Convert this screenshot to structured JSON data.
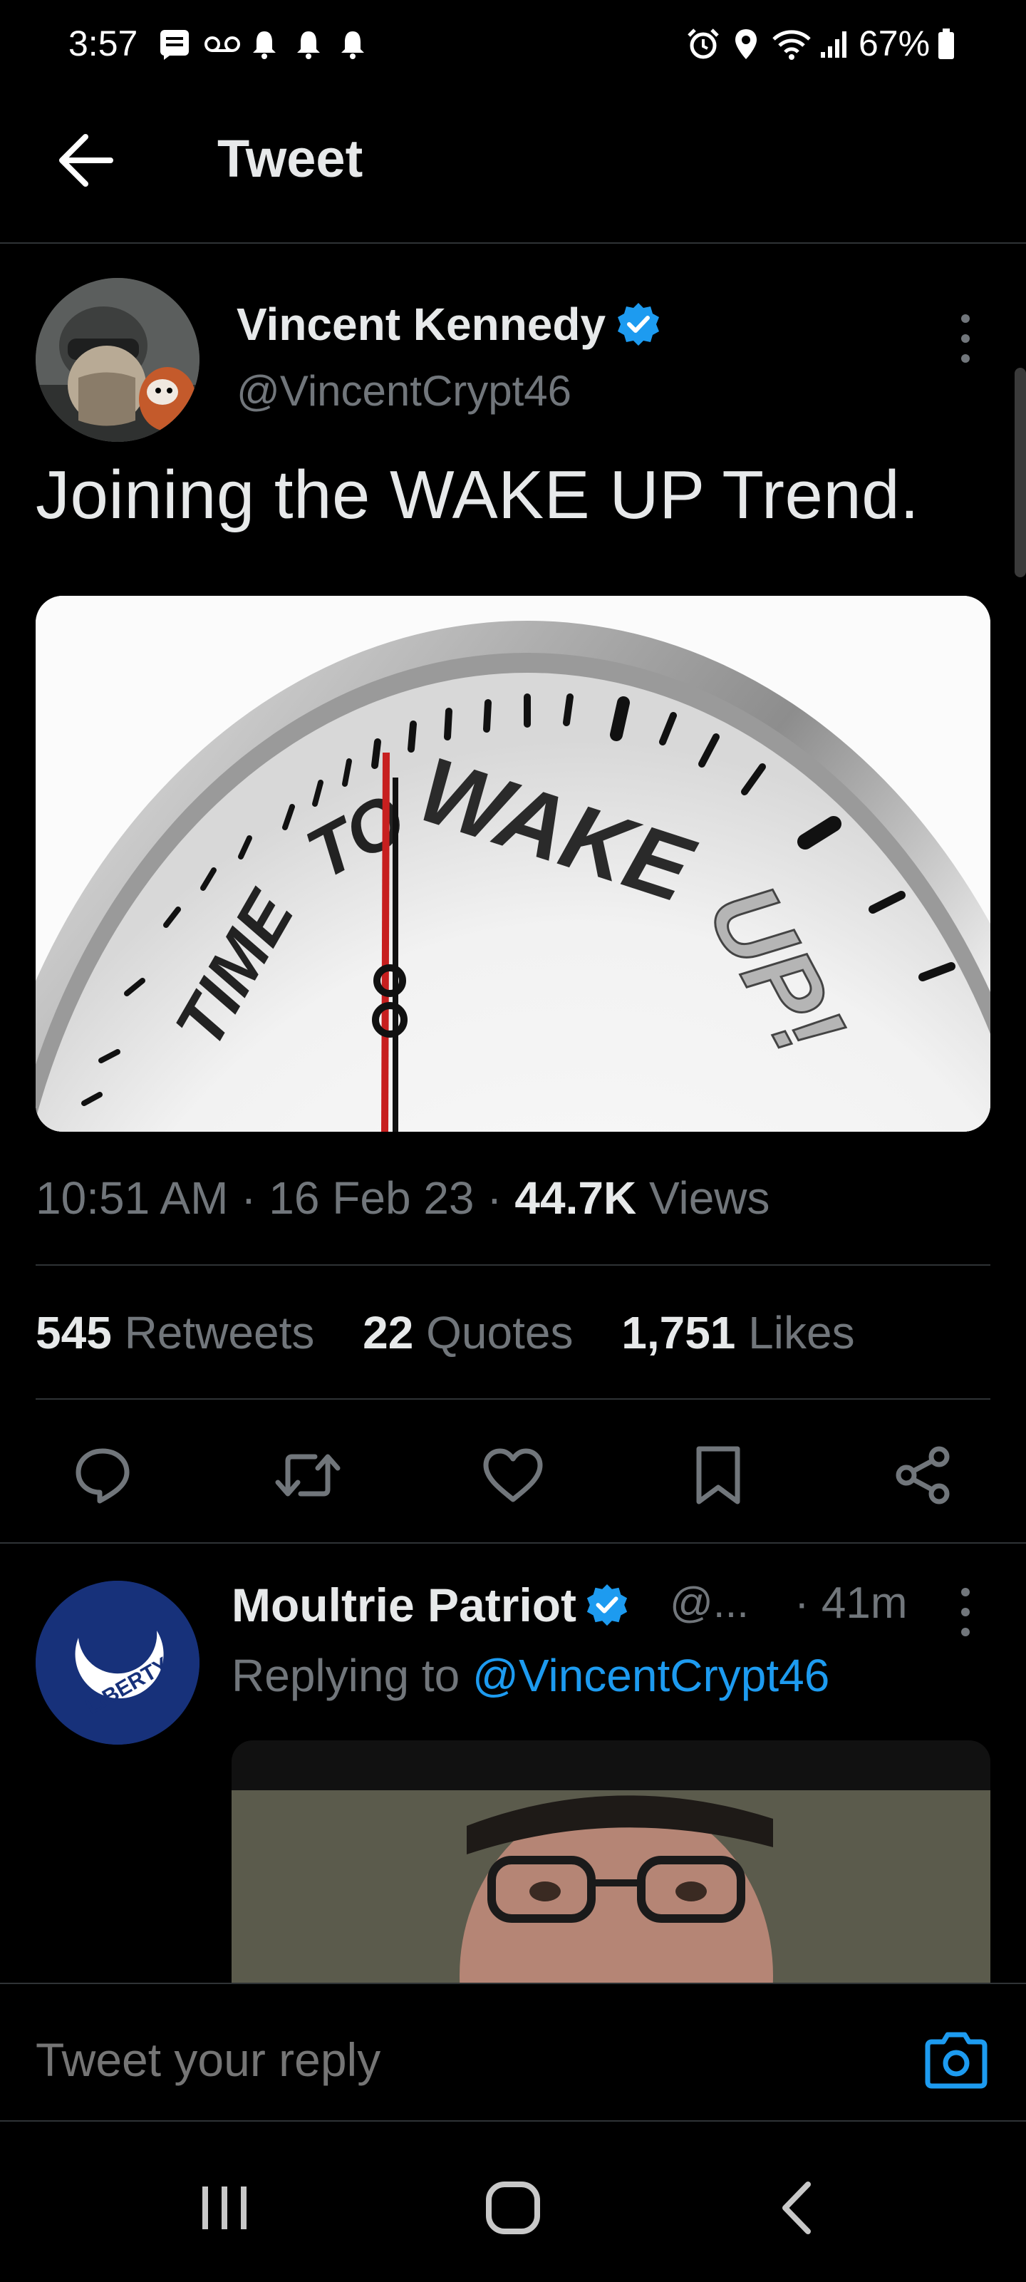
{
  "status_bar": {
    "time": "3:57",
    "battery": "67%",
    "icons": [
      "message-icon",
      "voicemail-icon",
      "bell-icon",
      "bell-icon",
      "bell-icon",
      "alarm-icon",
      "location-icon",
      "wifi-icon",
      "signal-icon",
      "battery-icon"
    ]
  },
  "header": {
    "title": "Tweet"
  },
  "tweet": {
    "display_name": "Vincent Kennedy",
    "handle": "@VincentCrypt46",
    "text": "Joining the WAKE UP Trend.",
    "media_words": [
      "TIME",
      "TO",
      "WAKE",
      "UP!"
    ],
    "time": "10:51 AM",
    "date": "16 Feb 23",
    "views_count": "44.7K",
    "views_label": "Views",
    "retweets_count": "545",
    "retweets_label": "Retweets",
    "quotes_count": "22",
    "quotes_label": "Quotes",
    "likes_count": "1,751",
    "likes_label": "Likes"
  },
  "reply": {
    "display_name": "Moultrie Patriot",
    "handle": "@...",
    "time": "· 41m",
    "replying_prefix": "Replying to",
    "replying_to": "@VincentCrypt46",
    "avatar_text": "LIBERTY"
  },
  "composer": {
    "placeholder": "Tweet your reply"
  },
  "colors": {
    "accent": "#1d9bf0",
    "background": "#000000",
    "muted": "#71767b",
    "text": "#e7e9ea"
  }
}
